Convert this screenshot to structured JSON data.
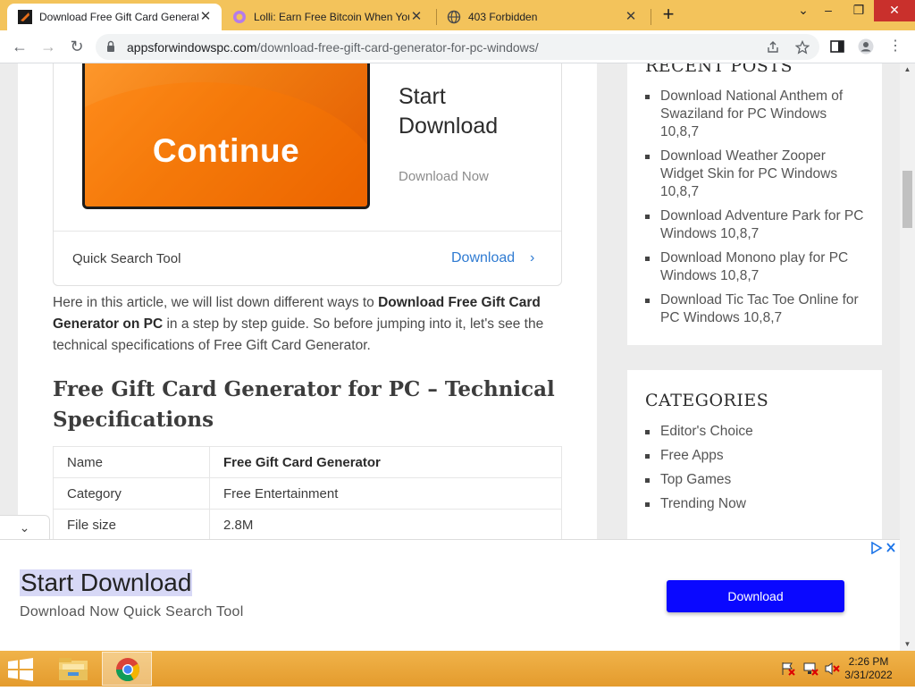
{
  "browser": {
    "tabs": [
      {
        "title": "Download Free Gift Card Generator for PC",
        "active": true
      },
      {
        "title": "Lolli: Earn Free Bitcoin When You Shop",
        "active": false
      },
      {
        "title": "403 Forbidden",
        "active": false
      }
    ],
    "url_host": "appsforwindowspc.com",
    "url_path": "/download-free-gift-card-generator-for-pc-windows/"
  },
  "ad_card": {
    "image_label": "Continue",
    "heading": "Start Download",
    "subtext": "Download Now",
    "footer_label": "Quick Search Tool",
    "footer_link": "Download"
  },
  "article": {
    "intro_prefix": "Here in this article, we will list down different ways to ",
    "intro_bold": "Download Free Gift Card Generator on PC",
    "intro_suffix": " in a step by step guide. So before jumping into it, let's see the technical specifications of Free Gift Card Generator.",
    "section_heading": "Free Gift Card Generator for PC – Technical Specifications",
    "specs": [
      {
        "key": "Name",
        "value": "Free Gift Card Generator",
        "bold": true
      },
      {
        "key": "Category",
        "value": "Free Entertainment",
        "bold": false
      },
      {
        "key": "File size",
        "value": "2.8M",
        "bold": false
      }
    ]
  },
  "sidebar": {
    "recent_title": "RECENT POSTS",
    "recent_posts": [
      "Download National Anthem of Swaziland for PC Windows 10,8,7",
      "Download Weather Zooper Widget Skin for PC Windows 10,8,7",
      "Download Adventure Park for PC Windows 10,8,7",
      "Download Monono play for PC Windows 10,8,7",
      "Download Tic Tac Toe Online for PC Windows 10,8,7"
    ],
    "categories_title": "CATEGORIES",
    "categories": [
      "Editor's Choice",
      "Free Apps",
      "Top Games",
      "Trending Now"
    ]
  },
  "banner": {
    "title": "Start Download",
    "subtitle": "Download Now Quick Search Tool",
    "button": "Download"
  },
  "taskbar": {
    "time": "2:26 PM",
    "date": "3/31/2022"
  },
  "colors": {
    "chrome_frame": "#f3c35b",
    "ad_button": "#0a08ff",
    "link_blue": "#2f7bd2",
    "ad_orange": "#f07b10"
  }
}
